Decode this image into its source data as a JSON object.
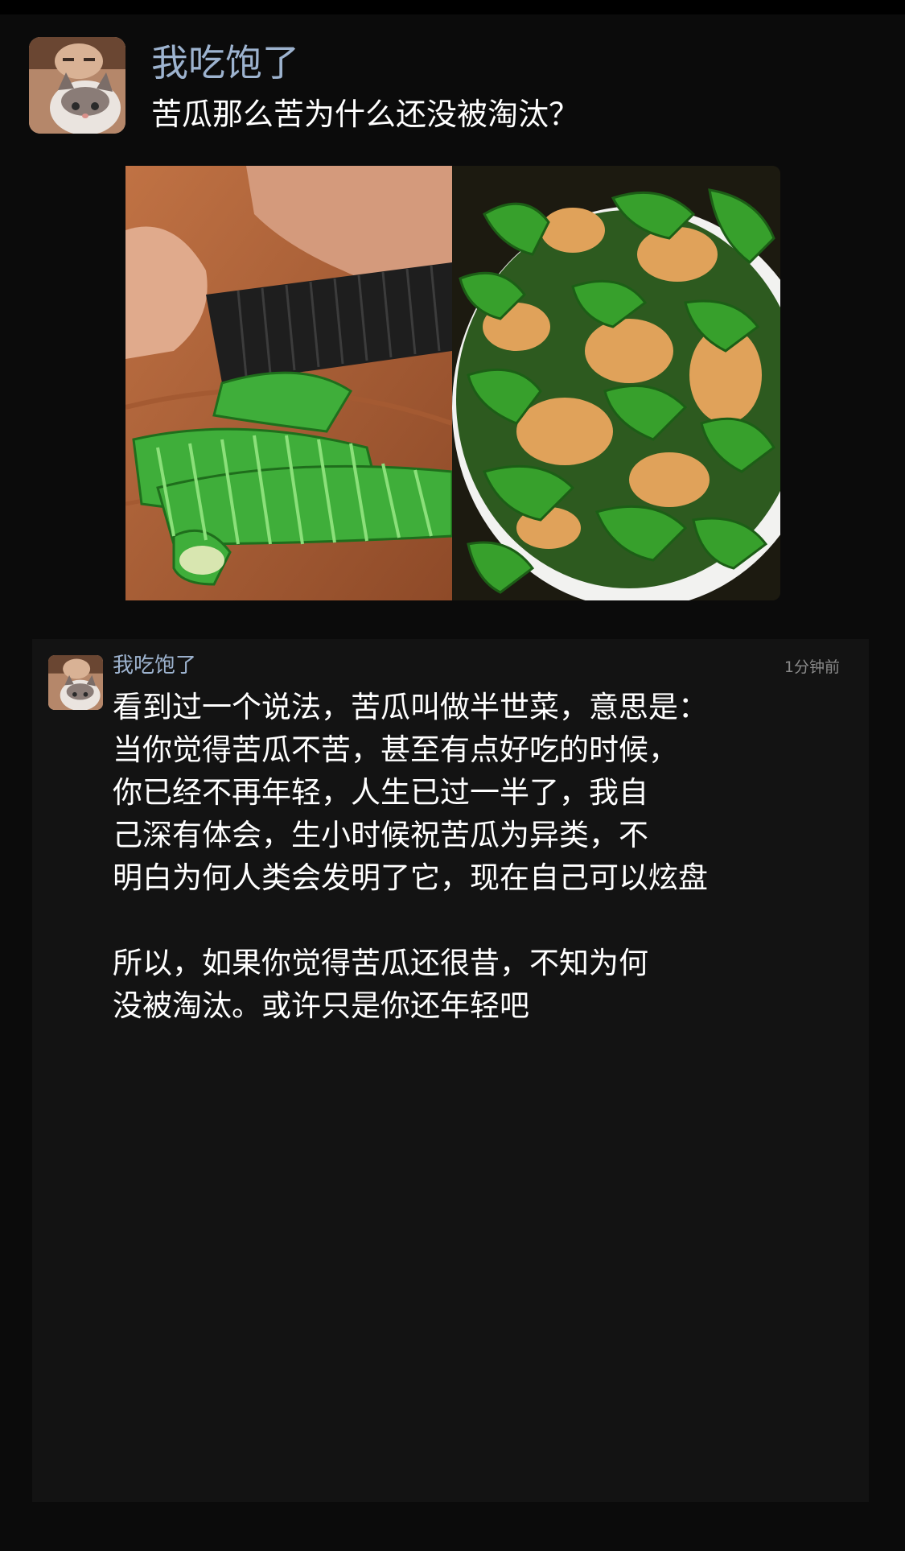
{
  "post": {
    "author": "我吃饱了",
    "title": "苦瓜那么苦为什么还没被淘汰？"
  },
  "comment": {
    "author": "我吃饱了",
    "time": "1分钟前",
    "paragraph1": [
      "看到过一个说法，苦瓜叫做半世菜，意思是：",
      "当你觉得苦瓜不苦，甚至有点好吃的时候，",
      "你已经不再年轻，人生已过一半了，我自",
      "己深有体会，生小时候祝苦瓜为异类，不",
      "明白为何人类会发明了它，现在自己可以炫盘"
    ],
    "paragraph2": [
      "所以，如果你觉得苦瓜还很昔，不知为何",
      "没被淘汰。或许只是你还年轻吧"
    ]
  },
  "colors": {
    "background": "#0b0b0b",
    "card": "#131313",
    "author_name": "#9db3cf",
    "text": "#ffffff",
    "timestamp": "#8a8a8a"
  }
}
